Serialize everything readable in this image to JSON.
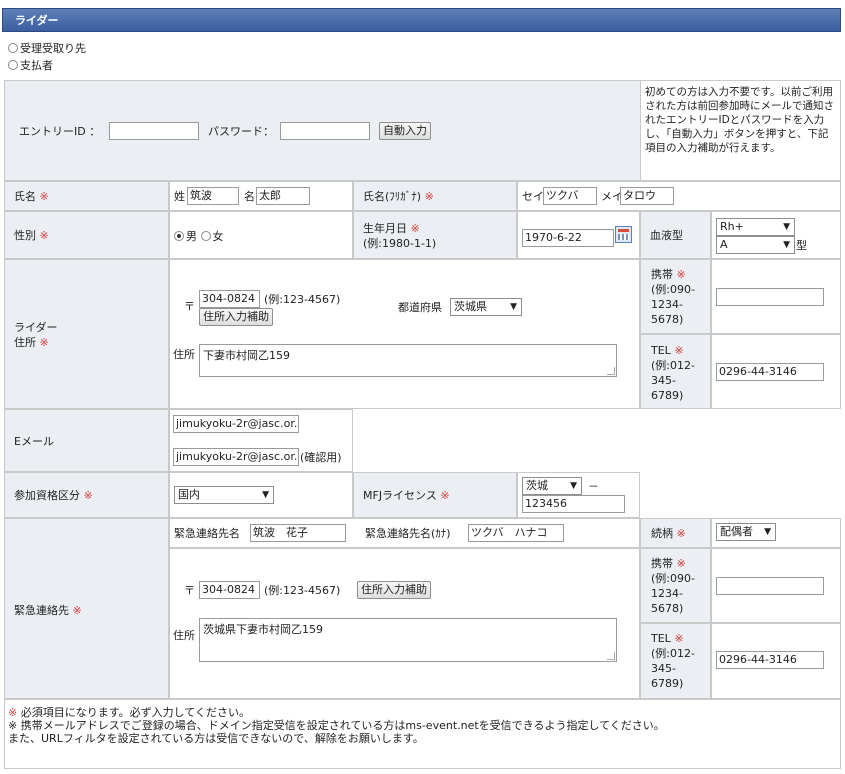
{
  "header": {
    "title": "ライダー"
  },
  "type_options": [
    {
      "label": "受理受取り先",
      "selected": false
    },
    {
      "label": "支払者",
      "selected": false
    }
  ],
  "entry": {
    "id_label": "エントリーID ：",
    "password_label": "パスワード：",
    "auto_button": "自動入力",
    "note": "初めての方は入力不要です。以前ご利用された方は前回参加時にメールで通知されたエントリーIDとパスワードを入力し、「自動入力」ボタンを押すと、下記項目の入力補助が行えます。"
  },
  "required_mark": "※",
  "name": {
    "label": "氏名",
    "sei_label": "姓",
    "sei": "筑波",
    "mei_label": "名",
    "mei": "太郎"
  },
  "kana": {
    "label": "氏名(ﾌﾘｶﾞﾅ)",
    "sei_label": "セイ",
    "sei": "ツクバ",
    "mei_label": "メイ",
    "mei": "タロウ"
  },
  "gender": {
    "label": "性別",
    "male": "男",
    "female": "女"
  },
  "birth": {
    "label_line1": "生年月日",
    "label_line2": "(例:1980-1-1)",
    "value": "1970-6-22"
  },
  "blood": {
    "label": "血液型",
    "rh": "Rh+",
    "abo": "A",
    "suffix": "型"
  },
  "rider_address": {
    "label_line1": "ライダー",
    "label_line2": "住所",
    "postal_mark": "〒",
    "postal": "304-0824",
    "postal_example": "(例:123-4567)",
    "assist_button": "住所入力補助",
    "pref_label": "都道府県",
    "pref": "茨城県",
    "address_label": "住所",
    "address": "下妻市村岡乙159"
  },
  "mobile": {
    "label": "携帯",
    "example_lines": [
      "(例:090-",
      "1234-",
      "5678)"
    ],
    "value": ""
  },
  "tel": {
    "label": "TEL",
    "example_lines": [
      "(例:012-",
      "345-",
      "6789)"
    ],
    "value": "0296-44-3146"
  },
  "email": {
    "label": "Eメール",
    "value": "jimukyoku-2r@jasc.or.",
    "confirm_value": "jimukyoku-2r@jasc.or.",
    "confirm_label": "(確認用)"
  },
  "category": {
    "label": "参加資格区分",
    "value": "国内"
  },
  "license": {
    "label": "MFJライセンス",
    "pref": "茨城",
    "dash": "－",
    "number": "123456"
  },
  "emergency": {
    "label": "緊急連絡先",
    "name_label": "緊急連絡先名",
    "name": "筑波　花子",
    "kana_label": "緊急連絡先名(ｶﾅ)",
    "kana": "ツクバ　ハナコ",
    "relation_label": "続柄",
    "relation": "配偶者",
    "postal_mark": "〒",
    "postal": "304-0824",
    "postal_example": "(例:123-4567)",
    "assist_button": "住所入力補助",
    "address_label": "住所",
    "address": "茨城県下妻市村岡乙159",
    "mobile": "",
    "tel": "0296-44-3146"
  },
  "notes": [
    "※ 必須項目になります。必ず入力してください。",
    "※ 携帯メールアドレスでご登録の場合、ドメイン指定受信を設定されている方はms-event.netを受信できるよう指定してください。",
    "また、URLフィルタを設定されている方は受信できないので、解除をお願いします。"
  ]
}
